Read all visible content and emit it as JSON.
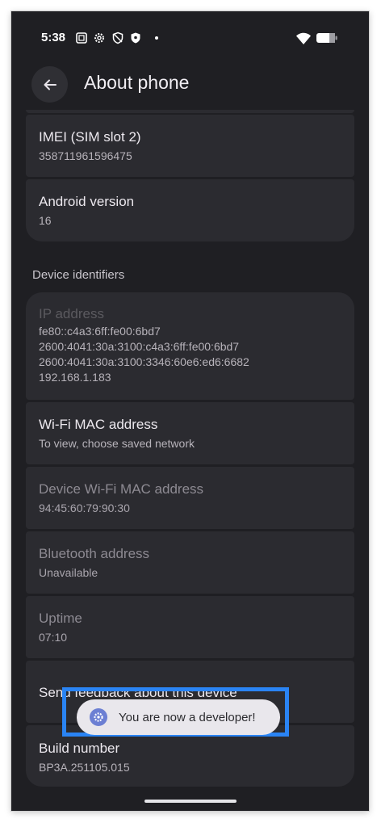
{
  "status_bar": {
    "time": "5:38",
    "left_icons": [
      "screen-record-icon",
      "gear-icon",
      "shield-outline-icon",
      "shield-filled-icon",
      "notification-dot-icon"
    ],
    "right_icons": [
      "wifi-icon",
      "battery-icon"
    ]
  },
  "header": {
    "title": "About phone",
    "back_icon": "arrow-left-icon"
  },
  "items_top": [
    {
      "title": "IMEI (SIM slot 2)",
      "value": "358711961596475"
    },
    {
      "title": "Android version",
      "value": "16"
    }
  ],
  "section": {
    "title": "Device identifiers"
  },
  "ip": {
    "title": "IP address",
    "lines": [
      "fe80::c4a3:6ff:fe00:6bd7",
      "2600:4041:30a:3100:c4a3:6ff:fe00:6bd7",
      "2600:4041:30a:3100:3346:60e6:ed6:6682",
      "192.168.1.183"
    ]
  },
  "wifi_mac": {
    "title": "Wi-Fi MAC address",
    "value": "To view, choose saved network"
  },
  "device_wifi_mac": {
    "title": "Device Wi-Fi MAC address",
    "value": "94:45:60:79:90:30"
  },
  "bluetooth": {
    "title": "Bluetooth address",
    "value": "Unavailable"
  },
  "uptime": {
    "title": "Uptime",
    "value": "07:10"
  },
  "feedback": {
    "title": "Send feedback about this device"
  },
  "build": {
    "title": "Build number",
    "value": "BP3A.251105.015"
  },
  "toast": {
    "text": "You are now a developer!",
    "icon": "gear-icon"
  },
  "colors": {
    "accent": "#2a84f4",
    "background": "#1f1f23",
    "card": "#2b2b30"
  }
}
